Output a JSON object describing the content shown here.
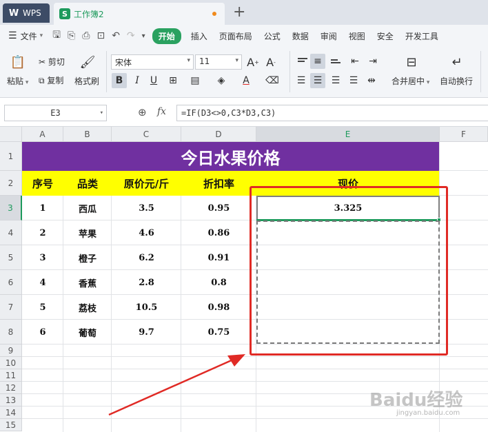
{
  "tabs": {
    "wps_label": "WPS",
    "workbook_label": "工作簿2",
    "new_tab": "+"
  },
  "menu": {
    "file": "文件",
    "items": [
      "开始",
      "插入",
      "页面布局",
      "公式",
      "数据",
      "审阅",
      "视图",
      "安全",
      "开发工具"
    ],
    "active": "开始"
  },
  "ribbon": {
    "paste": "粘贴",
    "cut": "剪切",
    "copy": "复制",
    "format_painter": "格式刷",
    "font_name": "宋体",
    "font_size": "11",
    "bold": "B",
    "italic": "I",
    "underline": "U",
    "merge_center": "合并居中",
    "auto_wrap": "自动换行"
  },
  "formula_bar": {
    "cell_ref": "E3",
    "fx": "fx",
    "formula": "=IF(D3<>0,C3*D3,C3)"
  },
  "sheet": {
    "columns": [
      "A",
      "B",
      "C",
      "D",
      "E",
      "F"
    ],
    "selected_column": "E",
    "rows": [
      "1",
      "2",
      "3",
      "4",
      "5",
      "6",
      "7",
      "8",
      "9",
      "10",
      "11",
      "12",
      "13",
      "14",
      "15"
    ],
    "selected_row": "3",
    "title": "今日水果价格",
    "title_color": "#7030A0",
    "header_color": "#FFFF00",
    "headers": [
      "序号",
      "品类",
      "原价元/斤",
      "折扣率",
      "现价"
    ],
    "data": [
      [
        "1",
        "西瓜",
        "3.5",
        "0.95",
        "3.325"
      ],
      [
        "2",
        "苹果",
        "4.6",
        "0.86",
        ""
      ],
      [
        "3",
        "橙子",
        "6.2",
        "0.91",
        ""
      ],
      [
        "4",
        "香蕉",
        "2.8",
        "0.8",
        ""
      ],
      [
        "5",
        "荔枝",
        "10.5",
        "0.98",
        ""
      ],
      [
        "6",
        "葡萄",
        "9.7",
        "0.75",
        ""
      ]
    ]
  },
  "annotation": {
    "highlight_color": "#E02A25"
  },
  "watermark": {
    "text": "Baidu经验",
    "sub": "jingyan.baidu.com"
  }
}
